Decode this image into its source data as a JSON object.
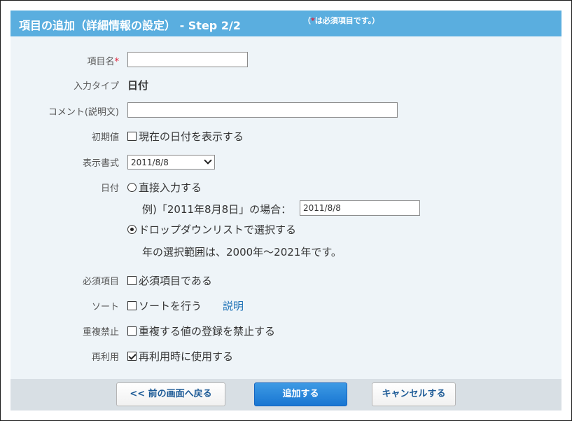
{
  "header": {
    "title": "項目の追加（詳細情報の設定） - Step 2/2",
    "note_open": "（",
    "note_star": "*",
    "note_text": "は必須項目です。）"
  },
  "fields": {
    "name": {
      "label": "項目名",
      "required_mark": "*",
      "value": ""
    },
    "input_type": {
      "label": "入力タイプ",
      "value": "日付"
    },
    "comment": {
      "label": "コメント(説明文)",
      "value": ""
    },
    "default": {
      "label": "初期値",
      "checkbox_label": "現在の日付を表示する",
      "checked": false
    },
    "format": {
      "label": "表示書式",
      "selected": "2011/8/8"
    },
    "date": {
      "label": "日付",
      "option_direct": "直接入力する",
      "example_text": "例)「2011年8月8日」の場合：",
      "example_value": "2011/8/8",
      "option_dropdown": "ドロップダウンリストで選択する",
      "range_text": "年の選択範囲は、2000年～2021年です。",
      "selected": "dropdown"
    },
    "required": {
      "label": "必須項目",
      "checkbox_label": "必須項目である",
      "checked": false
    },
    "sort": {
      "label": "ソート",
      "checkbox_label": "ソートを行う",
      "link": "説明",
      "checked": false
    },
    "no_duplicates": {
      "label": "重複禁止",
      "checkbox_label": "重複する値の登録を禁止する",
      "checked": false
    },
    "reuse": {
      "label": "再利用",
      "checkbox_label": "再利用時に使用する",
      "checked": true
    }
  },
  "footer": {
    "back_label": "<< 前の画面へ戻る",
    "add_label": "追加する",
    "cancel_label": "キャンセルする"
  },
  "colors": {
    "header_bg": "#5aaedf",
    "panel_bg": "#eef4f8",
    "footer_bg": "#d8dfe4",
    "primary_button": "#1976d2",
    "required_mark": "#e0213a",
    "link": "#1a6fb5"
  }
}
